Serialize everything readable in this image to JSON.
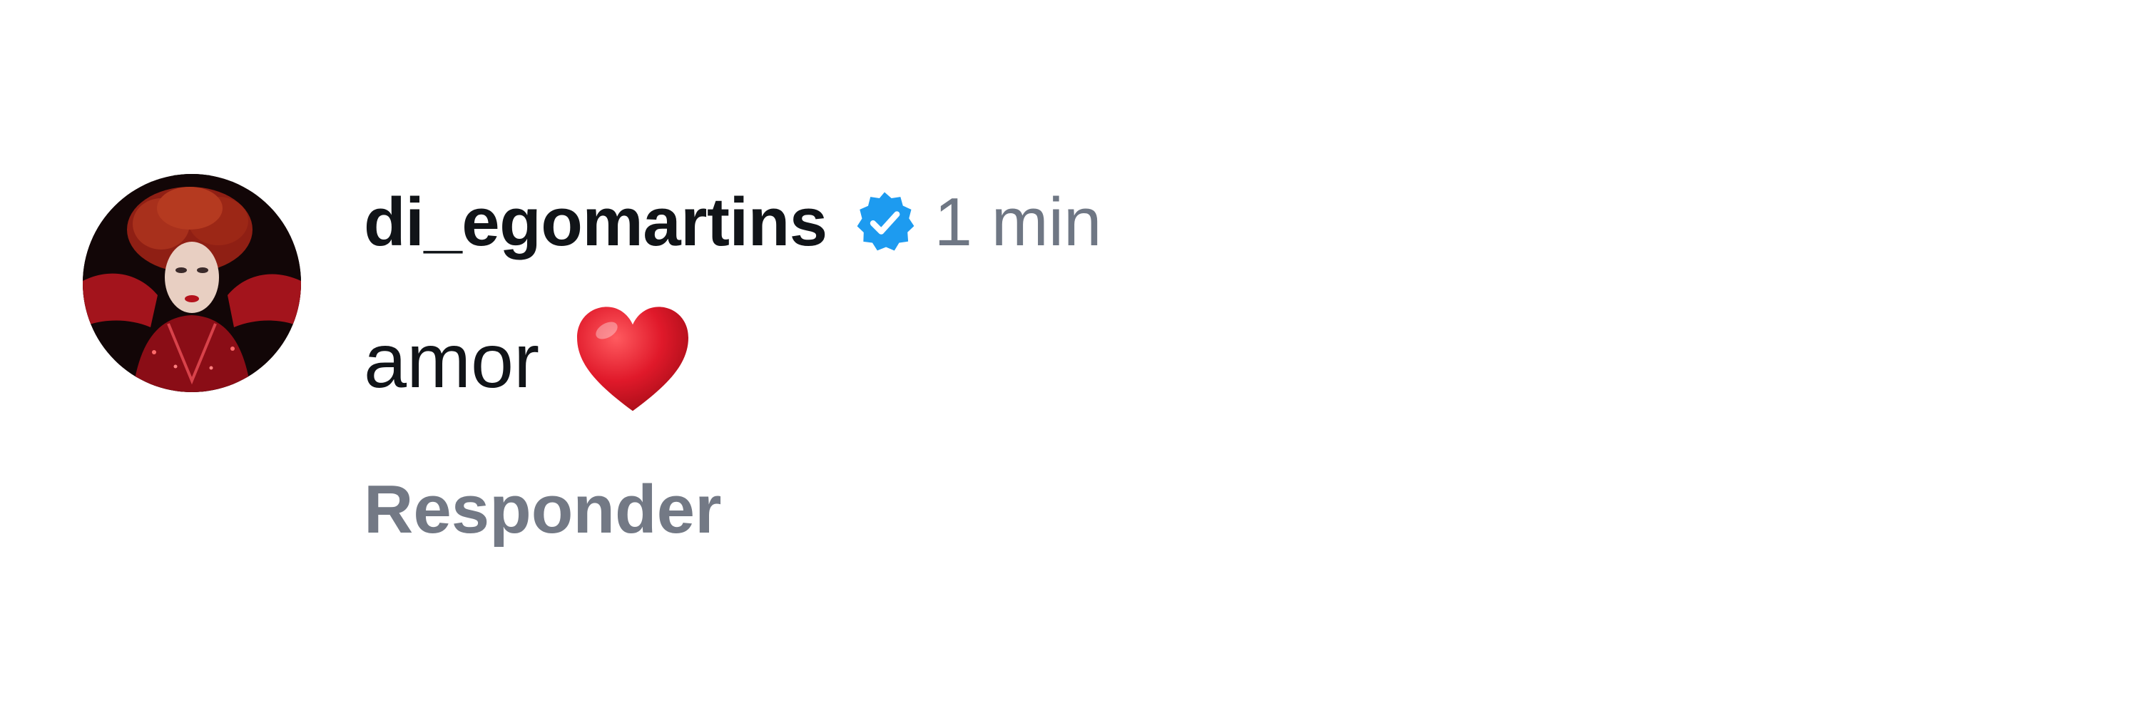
{
  "comment": {
    "username": "di_egomartins",
    "verified": true,
    "timestamp": "1 min",
    "text": "amor",
    "emoji": "heart-emoji",
    "reply_label": "Responder"
  },
  "icons": {
    "verified": "verified-badge-icon",
    "heart": "red-heart-emoji"
  },
  "colors": {
    "username": "#111418",
    "timestamp": "#6f7784",
    "reply": "#737985",
    "verified_badge": "#1d9bf0",
    "heart": "#e0192a"
  }
}
